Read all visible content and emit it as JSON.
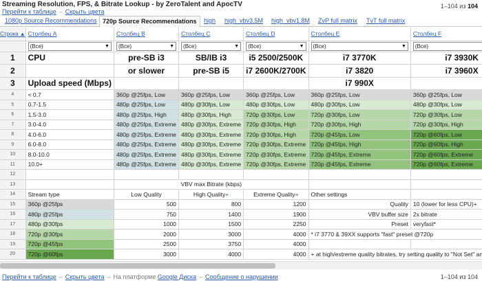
{
  "header": {
    "title": "Streaming Resolution, FPS, & Bitrate Lookup - by ZeroTalent and ApocTV",
    "link_table": "Перейти к таблице",
    "link_hide": "Скрыть цвета",
    "rowcount_prefix": "1–104 из ",
    "rowcount_total": "104"
  },
  "tabs": [
    {
      "label": "1080p Source Recommendations",
      "active": false
    },
    {
      "label": "720p Source Recommendations",
      "active": true
    },
    {
      "label": "high",
      "active": false
    },
    {
      "label": "high_vbv3.5M",
      "active": false
    },
    {
      "label": "high_vbv1.8M",
      "active": false
    },
    {
      "label": "ZvP full matrix",
      "active": false
    },
    {
      "label": "TvT full matrix",
      "active": false
    }
  ],
  "columns": {
    "rownum_header": "Строка ▲",
    "names": [
      "Столбец A",
      "Столбец B",
      "Столбец C",
      "Столбец D",
      "Столбец E",
      "Столбец F"
    ],
    "filter": "(Все)"
  },
  "rows": {
    "r1": {
      "n": "1",
      "cells": [
        "CPU",
        "pre-SB i3",
        "SB/IB i3",
        "i5 2500/2500K",
        "i7 3770K",
        "i7 3930K"
      ]
    },
    "r2": {
      "n": "2",
      "cells": [
        "",
        "or slower",
        "pre-SB i5",
        "i7 2600K/2700K",
        "i7 3820",
        "i7 3960X"
      ]
    },
    "r3": {
      "n": "3",
      "cells": [
        "Upload speed (Mbps)",
        "",
        "",
        "",
        "i7 990X",
        ""
      ]
    },
    "speed": [
      {
        "n": "4",
        "label": "< 0.7",
        "cells": [
          "360p @25fps, Low",
          "360p @25fps, Low",
          "360p @25fps, Low",
          "360p @25fps, Low",
          "360p @25fps, Low"
        ],
        "cls": [
          "g0",
          "g0",
          "g0",
          "g0",
          "g0"
        ]
      },
      {
        "n": "5",
        "label": "0.7-1.5",
        "cells": [
          "480p @25fps, Low",
          "480p @30fps, Low",
          "480p @30fps, Low",
          "480p @30fps, Low",
          "480p @30fps, Low"
        ],
        "cls": [
          "g1",
          "g2",
          "g2",
          "g2",
          "g2"
        ]
      },
      {
        "n": "6",
        "label": "1.5-3.0",
        "cells": [
          "480p @25fps, High",
          "480p @30fps, High",
          "720p @30fps, Low",
          "720p @30fps, Low",
          "720p @30fps, Low"
        ],
        "cls": [
          "g1",
          "g2",
          "g3",
          "g3",
          "g3"
        ]
      },
      {
        "n": "7",
        "label": "3.0-4.0",
        "cells": [
          "480p @25fps, Extreme",
          "480p @30fps, Extreme",
          "720p @30fps, High",
          "720p @30fps, High",
          "720p @30fps, High"
        ],
        "cls": [
          "g1",
          "g2",
          "g3",
          "g3",
          "g3"
        ]
      },
      {
        "n": "8",
        "label": "4.0-6.0",
        "cells": [
          "480p @25fps, Extreme",
          "480p @30fps, Extreme",
          "720p @30fps, High",
          "720p @45fps, Low",
          "720p @60fps, Low"
        ],
        "cls": [
          "g1",
          "g2",
          "g3",
          "g4",
          "g5"
        ]
      },
      {
        "n": "9",
        "label": "6.0-8.0",
        "cells": [
          "480p @25fps, Extreme",
          "480p @30fps, Extreme",
          "720p @30fps, Extreme",
          "720p @45fps, High",
          "720p @60fps, High"
        ],
        "cls": [
          "g1",
          "g2",
          "g3",
          "g4",
          "g5"
        ]
      },
      {
        "n": "10",
        "label": "8.0-10.0",
        "cells": [
          "480p @25fps, Extreme",
          "480p @30fps, Extreme",
          "720p @30fps, Extreme",
          "720p @45fps, Extreme",
          "720p @60fps, Extreme"
        ],
        "cls": [
          "g1",
          "g2",
          "g3",
          "g4",
          "g5"
        ]
      },
      {
        "n": "11",
        "label": "10.0+",
        "cells": [
          "480p @25fps, Extreme",
          "480p @30fps, Extreme",
          "720p @30fps, Extreme",
          "720p @45fps, Extreme",
          "720p @60fps, Extreme"
        ],
        "cls": [
          "g1",
          "g2",
          "g3",
          "g4",
          "g5"
        ]
      }
    ],
    "r12": {
      "n": "12"
    },
    "r13": {
      "n": "13",
      "label": "VBV max Bitrate (kbps)"
    },
    "r14": {
      "n": "14",
      "a": "Stream type",
      "b": "Low Quality",
      "c": "High Quality",
      "d": "Extreme Quality",
      "e": "Other settings"
    },
    "bitrate": [
      {
        "n": "15",
        "type": "360p @25fps",
        "low": "500",
        "high": "800",
        "ext": "1200",
        "e": "Quality",
        "f": "10 (lower for less CPU)+",
        "cls": "g0"
      },
      {
        "n": "16",
        "type": "480p @25fps",
        "low": "750",
        "high": "1400",
        "ext": "1900",
        "e": "VBV buffer size",
        "f": "2x bitrate",
        "cls": "g1"
      },
      {
        "n": "17",
        "type": "480p @30fps",
        "low": "1000",
        "high": "1500",
        "ext": "2250",
        "e": "Preset",
        "f": "veryfast*",
        "cls": "g2"
      },
      {
        "n": "18",
        "type": "720p @30fps",
        "low": "2000",
        "high": "3000",
        "ext": "4000",
        "e": "* i7 3770 & 39XX supports \"fast\" preset @720p",
        "f": "",
        "cls": "g3"
      },
      {
        "n": "19",
        "type": "720p @45fps",
        "low": "2500",
        "high": "3750",
        "ext": "4000",
        "e": "",
        "f": "",
        "cls": "g4"
      },
      {
        "n": "20",
        "type": "720p @60fps",
        "low": "3000",
        "high": "4000",
        "ext": "4000",
        "e": "+ at high/extreme quality bitrates, try setting quality to \"Not Set\" and preset to",
        "f": "",
        "cls": "g5"
      }
    ]
  },
  "footer": {
    "link_table": "Перейти к таблице",
    "link_hide": "Скрыть цвета",
    "platform_prefix": "На платформе",
    "platform_link": "Google Диска",
    "report": "Сообщение о нарушении",
    "rowcount": "1–104 из 104"
  }
}
